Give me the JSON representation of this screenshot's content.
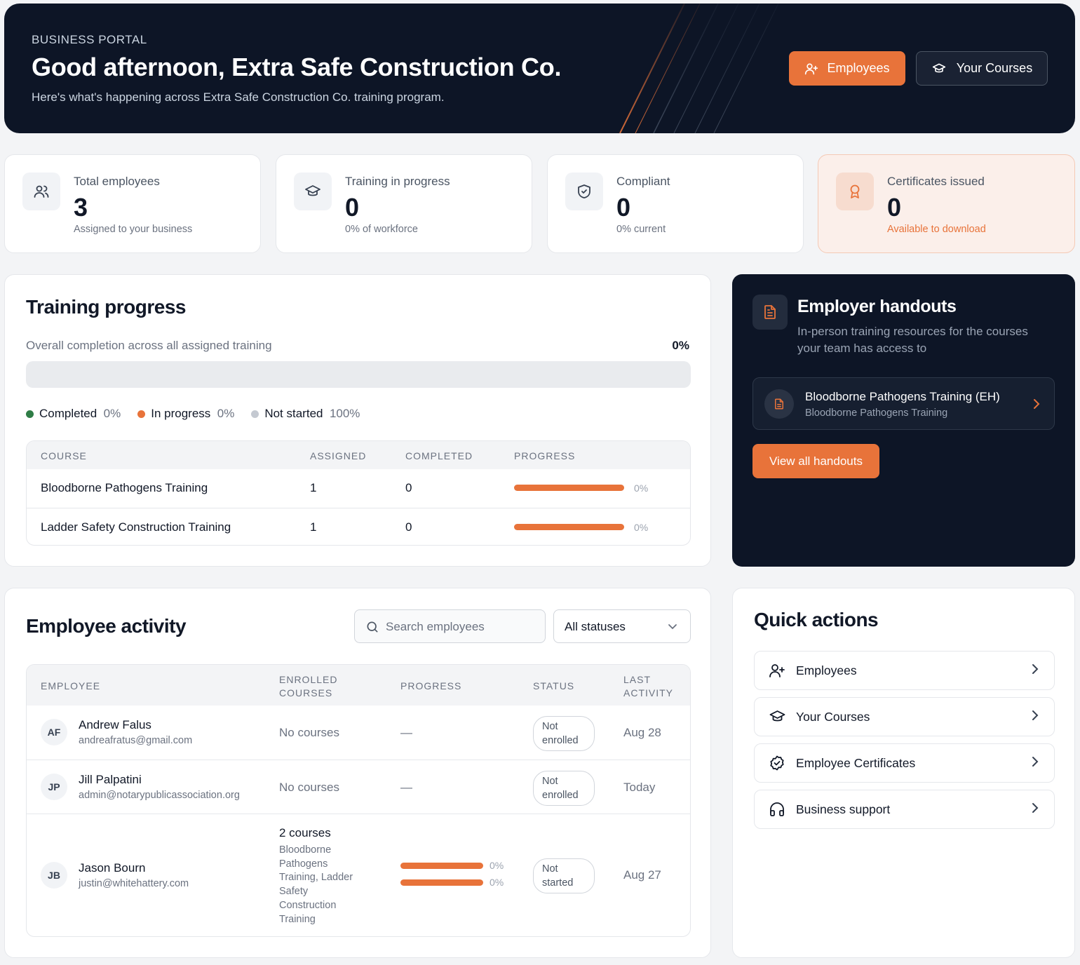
{
  "hero": {
    "eyebrow": "BUSINESS PORTAL",
    "title": "Good afternoon, Extra Safe Construction Co.",
    "subtitle": "Here's what's happening across Extra Safe Construction Co. training program.",
    "employees_button": "Employees",
    "courses_button": "Your Courses"
  },
  "stats": [
    {
      "label": "Total employees",
      "value": "3",
      "note": "Assigned to your business",
      "icon": "users-icon"
    },
    {
      "label": "Training in progress",
      "value": "0",
      "note": "0% of workforce",
      "icon": "graduation-cap-icon"
    },
    {
      "label": "Compliant",
      "value": "0",
      "note": "0% current",
      "icon": "shield-check-icon"
    },
    {
      "label": "Certificates issued",
      "value": "0",
      "note": "Available to download",
      "icon": "award-icon"
    }
  ],
  "training_progress": {
    "title": "Training progress",
    "overall_label": "Overall completion across all assigned training",
    "overall_value": "0%",
    "overall_fraction": 0,
    "legend": [
      {
        "label": "Completed",
        "value": "0%",
        "color": "#2f7d46"
      },
      {
        "label": "In progress",
        "value": "0%",
        "color": "#e8733a"
      },
      {
        "label": "Not started",
        "value": "100%",
        "color": "#c4c9d1"
      }
    ],
    "columns": [
      "COURSE",
      "ASSIGNED",
      "COMPLETED",
      "PROGRESS"
    ],
    "rows": [
      {
        "course": "Bloodborne Pathogens Training",
        "assigned": "1",
        "completed": "0",
        "progress": "0%"
      },
      {
        "course": "Ladder Safety Construction Training",
        "assigned": "1",
        "completed": "0",
        "progress": "0%"
      }
    ]
  },
  "handouts": {
    "title": "Employer handouts",
    "subtitle_line1": "In-person training resources for the courses",
    "subtitle_line2": "your team has access to",
    "item_title": "Bloodborne Pathogens Training (EH)",
    "item_sub": "Bloodborne Pathogens Training",
    "view_all": "View all handouts"
  },
  "activity": {
    "title": "Employee activity",
    "search_placeholder": "Search employees",
    "status_filter": "All statuses",
    "columns": {
      "employee": "EMPLOYEE",
      "enrolled_1": "ENROLLED",
      "enrolled_2": "COURSES",
      "progress": "PROGRESS",
      "status": "STATUS",
      "last_1": "LAST",
      "last_2": "ACTIVITY"
    },
    "rows": [
      {
        "initials": "AF",
        "name": "Andrew Falus",
        "email": "andreafratus@gmail.com",
        "courses": "No courses",
        "progress": "—",
        "status_1": "Not",
        "status_2": "enrolled",
        "last": "Aug 28"
      },
      {
        "initials": "JP",
        "name": "Jill Palpatini",
        "email": "admin@notarypublicassociation.org",
        "courses": "No courses",
        "progress": "—",
        "status_1": "Not",
        "status_2": "enrolled",
        "last": "Today"
      },
      {
        "initials": "JB",
        "name": "Jason Bourn",
        "email": "justin@whitehattery.com",
        "courses": "2 courses",
        "course_lines": [
          "Bloodborne",
          "Pathogens",
          "Training, Ladder",
          "Safety",
          "Construction",
          "Training"
        ],
        "bars": [
          "0%",
          "0%"
        ],
        "status_1": "Not",
        "status_2": "started",
        "last": "Aug 27"
      }
    ]
  },
  "quick_actions": {
    "title": "Quick actions",
    "items": [
      {
        "label": "Employees",
        "icon": "user-plus-icon"
      },
      {
        "label": "Your Courses",
        "icon": "graduation-cap-icon"
      },
      {
        "label": "Employee Certificates",
        "icon": "badge-check-icon"
      },
      {
        "label": "Business support",
        "icon": "headphones-icon"
      }
    ]
  },
  "colors": {
    "accent": "#e8733a",
    "navy": "#0d1526"
  }
}
